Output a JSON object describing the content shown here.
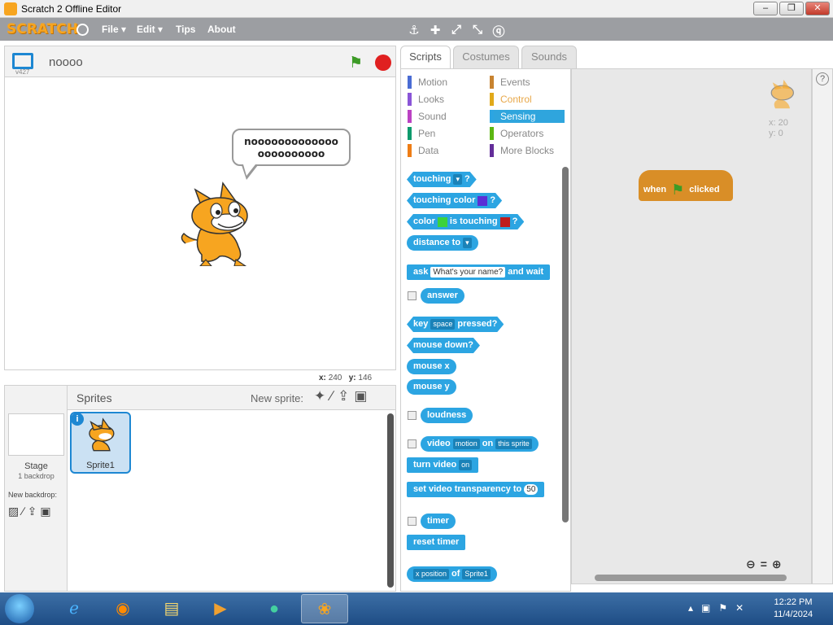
{
  "window": {
    "title": "Scratch 2 Offline Editor",
    "min": "–",
    "max": "❐",
    "close": "✕"
  },
  "menu": {
    "logo": "SCRATCH",
    "file": "File ▾",
    "edit": "Edit ▾",
    "tips": "Tips",
    "about": "About"
  },
  "stage": {
    "version": "v427",
    "project_name": "noooo",
    "bubble_line1": "nooooooooooooo",
    "bubble_line2": "oooooooooo",
    "x_label": "x:",
    "x_value": "240",
    "y_label": "y:",
    "y_value": "146"
  },
  "sprites_panel": {
    "stage_label": "Stage",
    "backdrop_count": "1 backdrop",
    "new_backdrop": "New backdrop:",
    "title": "Sprites",
    "new_sprite": "New sprite:",
    "sprite_name": "Sprite1"
  },
  "tabs": {
    "scripts": "Scripts",
    "costumes": "Costumes",
    "sounds": "Sounds"
  },
  "categories": {
    "motion": "Motion",
    "looks": "Looks",
    "sound": "Sound",
    "pen": "Pen",
    "data": "Data",
    "events": "Events",
    "control": "Control",
    "sensing": "Sensing",
    "operators": "Operators",
    "more": "More Blocks"
  },
  "category_colors": {
    "motion": "#4a6cd4",
    "looks": "#8a55d7",
    "sound": "#bb42c3",
    "pen": "#0e9a6c",
    "data": "#ee7d16",
    "events": "#c88330",
    "control": "#e1a91a",
    "sensing": "#2ca5e2",
    "operators": "#5cb712",
    "more": "#632d99"
  },
  "blocks": {
    "touching": "touching",
    "touching_color": "touching color",
    "color": "color",
    "is_touching": "is touching",
    "distance_to": "distance to",
    "ask": "ask",
    "ask_default": "What's your name?",
    "and_wait": "and wait",
    "answer": "answer",
    "key": "key",
    "key_space": "space",
    "pressed": "pressed?",
    "mouse_down": "mouse down?",
    "mouse_x": "mouse x",
    "mouse_y": "mouse y",
    "loudness": "loudness",
    "video": "video",
    "video_motion": "motion",
    "on": "on",
    "this_sprite": "this sprite",
    "turn_video": "turn video",
    "turn_on": "on",
    "set_video_transparency": "set video transparency to",
    "transparency_value": "50",
    "timer": "timer",
    "reset_timer": "reset timer",
    "x_position": "x position",
    "of": "of",
    "of_sprite": "Sprite1"
  },
  "script_area": {
    "when": "when",
    "clicked": "clicked",
    "x_readout": "x: 20",
    "y_readout": "y: 0"
  },
  "taskbar": {
    "time": "12:22 PM",
    "date": "11/4/2024"
  }
}
